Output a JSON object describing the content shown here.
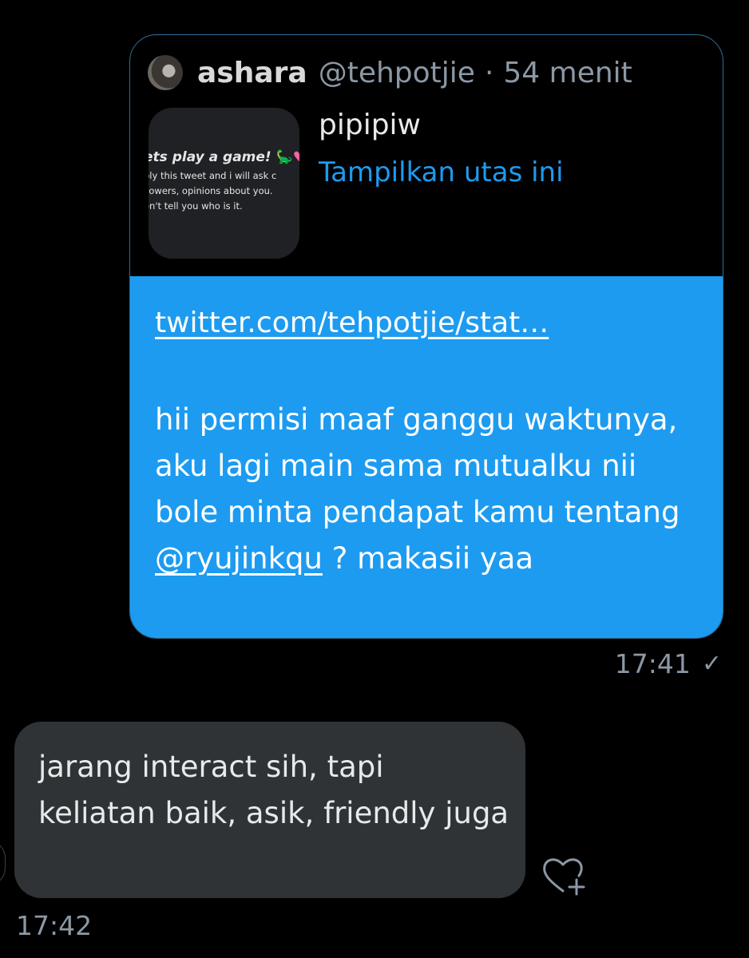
{
  "quote": {
    "name": "ashara",
    "handle": "@tehpotjie",
    "separator": "·",
    "time": "54 menit",
    "text": "pipipiw",
    "show_thread": "Tampilkan utas ini",
    "thumbnail": {
      "title": "ets play a game!",
      "lines": [
        "ply this tweet and i will ask c",
        "llowers, opinions about you.",
        "on't tell you who is it."
      ]
    }
  },
  "outgoing": {
    "link": "twitter.com/tehpotjie/stat…",
    "body_before": "hii permisi maaf ganggu waktunya, aku lagi main sama mutualku nii bole minta pendapat kamu tentang",
    "mention": "@ryujinkqu",
    "body_after": "? makasii yaa",
    "time": "17:41",
    "status_icon": "check-icon"
  },
  "incoming": {
    "text": "jarang interact sih, tapi keliatan baik, asik, friendly juga",
    "time": "17:42",
    "react_icon": "heart-plus-icon"
  },
  "colors": {
    "accent": "#1d9bf0",
    "incoming_bubble": "#2f3336",
    "background": "#000000",
    "secondary_text": "#8b98a5"
  }
}
